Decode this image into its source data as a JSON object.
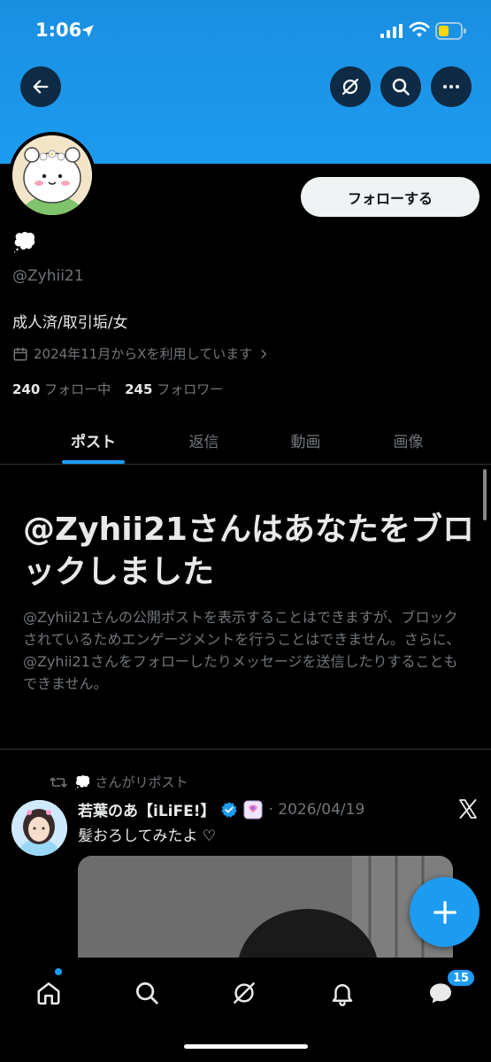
{
  "status_bar": {
    "time": "1:06",
    "icons": [
      "location-arrow-icon",
      "signal-icon",
      "wifi-icon",
      "battery-icon"
    ]
  },
  "header": {
    "buttons": [
      "back-arrow-icon",
      "grok-icon",
      "search-icon",
      "more-icon"
    ]
  },
  "profile": {
    "display_name": "💭",
    "handle": "@Zyhii21",
    "bio": "成人済/取引垢/女",
    "joined": "2024年11月からXを利用しています",
    "following_count": "240",
    "following_label": "フォロー中",
    "followers_count": "245",
    "followers_label": "フォロワー",
    "follow_button": "フォローする"
  },
  "tabs": [
    "ポスト",
    "返信",
    "動画",
    "画像"
  ],
  "active_tab": "ポスト",
  "blocked_notice": {
    "title": "@Zyhii21さんはあなたをブロックしました",
    "description": "@Zyhii21さんの公開ポストを表示することはできますが、ブロックされているためエンゲージメントを行うことはできません。さらに、@Zyhii21さんをフォローしたりメッセージを送信したりすることもできません。"
  },
  "post": {
    "repost_label": "💭 さんがリポスト",
    "author": "若葉のあ【iLiFE!】",
    "date": "· 2026/04/19",
    "text": "髪おろしてみたよ ♡"
  },
  "bottom_nav": {
    "items": [
      "home-icon",
      "search-icon",
      "grok-icon",
      "notifications-icon",
      "messages-icon"
    ],
    "messages_badge": "15"
  },
  "colors": {
    "accent": "#1d9bf0",
    "background": "#000000",
    "secondary_text": "#71767b",
    "banner": "#1d9bf0"
  }
}
